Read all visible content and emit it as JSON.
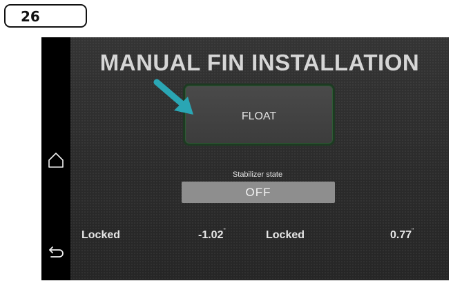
{
  "step": {
    "number": "26"
  },
  "screen": {
    "title": "MANUAL FIN INSTALLATION",
    "float_button": {
      "label": "FLOAT"
    },
    "stabilizer": {
      "label": "Stabilizer state",
      "value": "OFF"
    },
    "fins": [
      {
        "status": "Locked",
        "value": "-1.02",
        "unit": "\""
      },
      {
        "status": "Locked",
        "value": "0.77",
        "unit": "\""
      }
    ]
  },
  "icons": {
    "home": "home-icon",
    "back": "back-icon",
    "pointer": "pointer-arrow-icon"
  },
  "colors": {
    "background": "#2b2b2b",
    "button_border": "#1d3a22",
    "arrow": "#2aa6b4",
    "state_box": "#8e8e8e"
  }
}
